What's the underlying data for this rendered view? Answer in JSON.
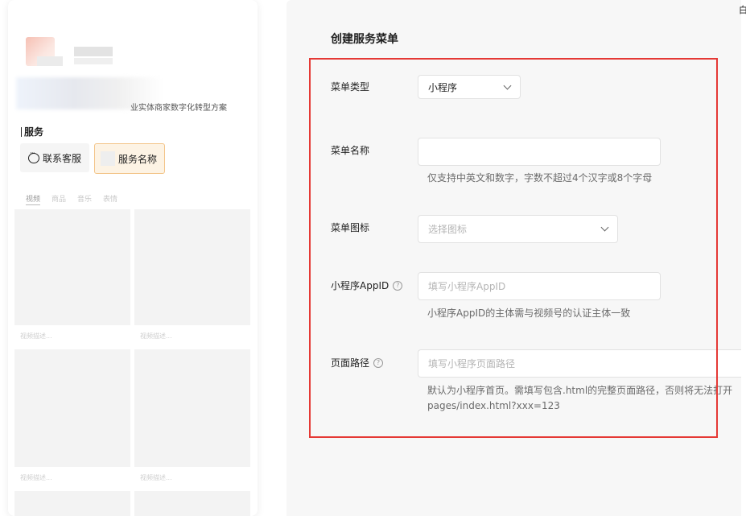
{
  "preview": {
    "desc_tail": "业实体商家数字化转型方案",
    "section_title": "服务",
    "contact_button": "联系客服",
    "service_button": "服务名称",
    "tabs": [
      "视频",
      "商品",
      "音乐",
      "表情"
    ],
    "card_caption": "视频描述..."
  },
  "form": {
    "title": "创建服务菜单",
    "menu_type": {
      "label": "菜单类型",
      "value": "小程序"
    },
    "menu_name": {
      "label": "菜单名称",
      "value": "",
      "hint": "仅支持中英文和数字，字数不超过4个汉字或8个字母"
    },
    "menu_icon": {
      "label": "菜单图标",
      "placeholder": "选择图标"
    },
    "appid": {
      "label": "小程序AppID",
      "placeholder": "填写小程序AppID",
      "hint": "小程序AppID的主体需与视频号的认证主体一致"
    },
    "page_path": {
      "label": "页面路径",
      "placeholder": "填写小程序页面路径",
      "hint_line1": "默认为小程序首页。需填写包含.html的完整页面路径，否则将无法打开",
      "hint_line2": "pages/index.html?xxx=123"
    }
  },
  "edge_char": "白",
  "colors": {
    "highlight_box": "#e53935",
    "service_button_border": "#f3c488",
    "panel_bg": "#f7f7f7"
  }
}
